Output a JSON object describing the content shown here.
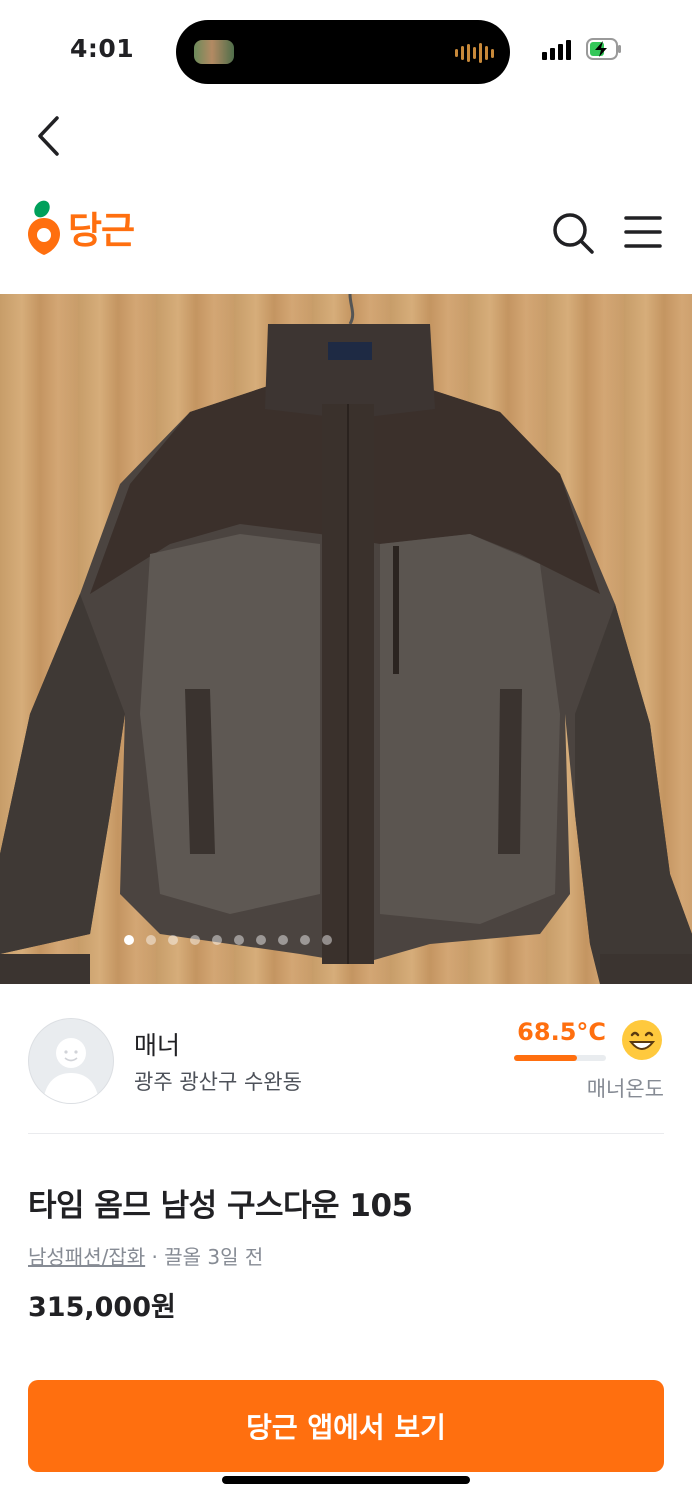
{
  "status_bar": {
    "time": "4:01",
    "signal": "signal-bars-icon",
    "battery": "battery-charging-icon"
  },
  "nav": {
    "back_icon": "chevron-left-icon",
    "logo_text": "당근",
    "search_icon": "search-icon",
    "menu_icon": "hamburger-menu-icon"
  },
  "gallery": {
    "image_count": 10,
    "current_index": 1
  },
  "seller": {
    "name": "매너",
    "location": "광주 광산구 수완동",
    "manner_temperature": "68.5°C",
    "manner_temperature_fraction": 0.685,
    "manner_label": "매너온도",
    "temperature_icon": "grinning-face-icon"
  },
  "item": {
    "title": "타임 옴므 남성 구스다운 105",
    "category": "남성패션/잡화",
    "time_ago": " · 끌올 3일 전",
    "price": "315,000원"
  },
  "cta": {
    "label": "당근 앱에서 보기"
  },
  "colors": {
    "brand": "#ff6f0f",
    "text_primary": "#212124",
    "text_secondary": "#868b94"
  }
}
